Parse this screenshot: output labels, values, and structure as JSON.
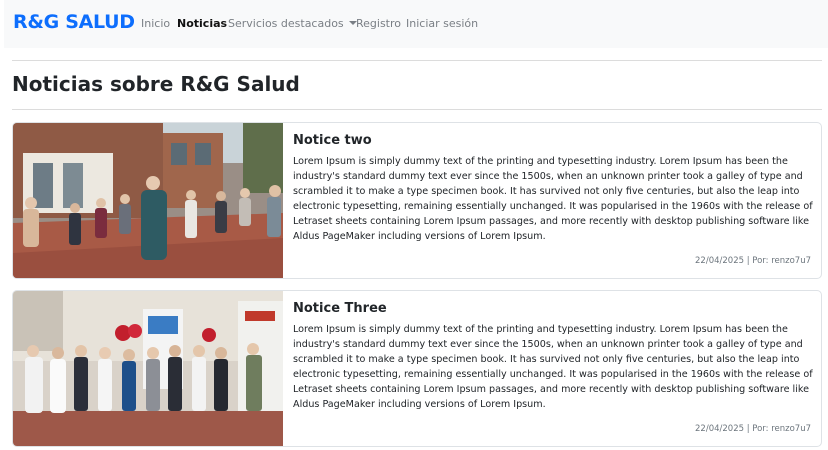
{
  "navbar": {
    "brand": "R&G SALUD",
    "items": [
      {
        "label": "Inicio",
        "active": false
      },
      {
        "label": "Noticias",
        "active": true
      },
      {
        "label": "Servicios destacados",
        "active": false,
        "dropdown": true
      },
      {
        "label": "Registro",
        "active": false
      },
      {
        "label": "Iniciar sesión",
        "active": false
      }
    ]
  },
  "page": {
    "title": "Noticias sobre R&G Salud"
  },
  "news": [
    {
      "title": "Notice two",
      "text": "Lorem Ipsum is simply dummy text of the printing and typesetting industry. Lorem Ipsum has been the industry's standard dummy text ever since the 1500s, when an unknown printer took a galley of type and scrambled it to make a type specimen book. It has survived not only five centuries, but also the leap into electronic typesetting, remaining essentially unchanged. It was popularised in the 1960s with the release of Letraset sheets containing Lorem Ipsum passages, and more recently with desktop publishing software like Aldus PageMaker including versions of Lorem Ipsum.",
      "meta": "22/04/2025 | Por: renzo7u7",
      "image": "outdoor-exercise-group-photo"
    },
    {
      "title": "Notice Three",
      "text": "Lorem Ipsum is simply dummy text of the printing and typesetting industry. Lorem Ipsum has been the industry's standard dummy text ever since the 1500s, when an unknown printer took a galley of type and scrambled it to make a type specimen book. It has survived not only five centuries, but also the leap into electronic typesetting, remaining essentially unchanged. It was popularised in the 1960s with the release of Letraset sheets containing Lorem Ipsum passages, and more recently with desktop publishing software like Aldus PageMaker including versions of Lorem Ipsum.",
      "meta": "22/04/2025 | Por: renzo7u7",
      "image": "health-event-group-photo"
    }
  ],
  "colors": {
    "brand": "#0d6efd",
    "navbar_bg": "#f8f9fa",
    "muted": "#6c757d"
  }
}
